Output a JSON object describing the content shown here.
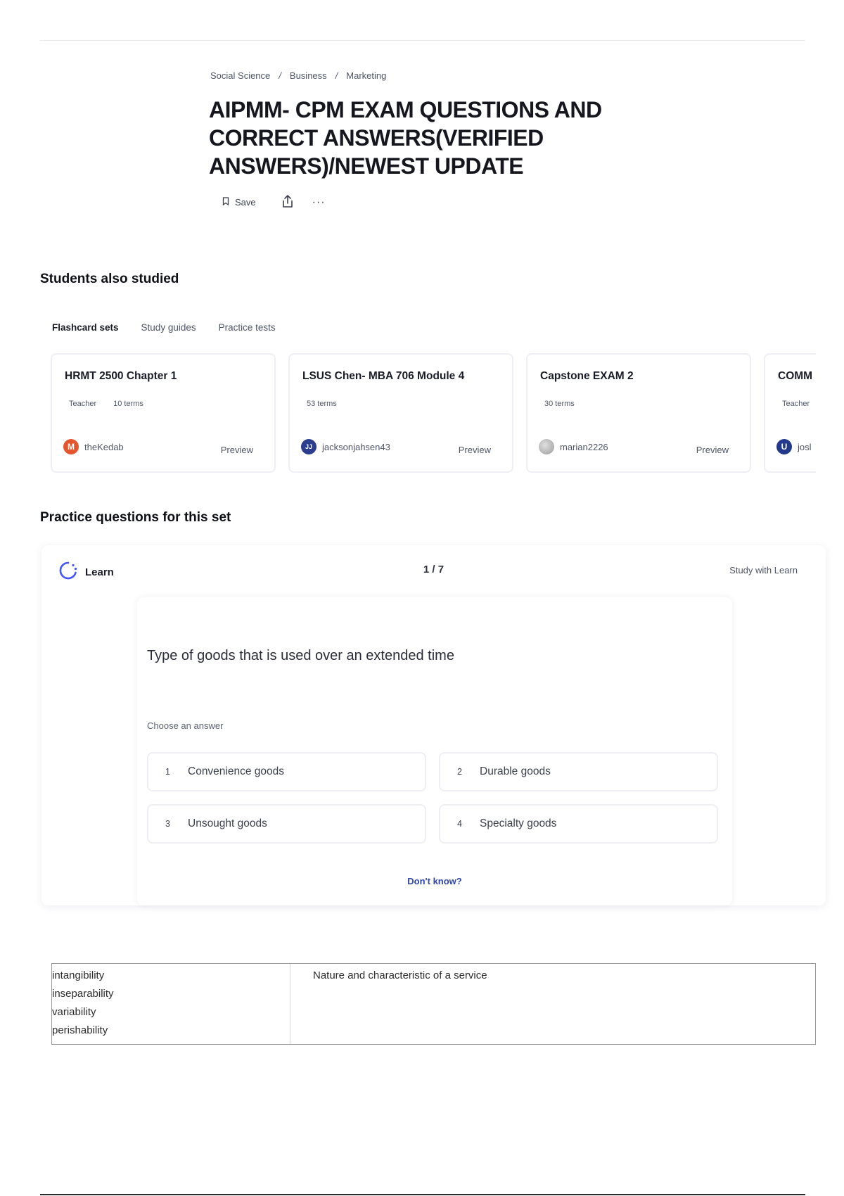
{
  "breadcrumb": [
    "Social Science",
    "Business",
    "Marketing"
  ],
  "breadcrumb_separator": "/",
  "title": "AIPMM- CPM EXAM QUESTIONS AND CORRECT ANSWERS(VERIFIED ANSWERS)/NEWEST UPDATE",
  "actions": {
    "save_label": "Save",
    "more_label": "···"
  },
  "also_studied": {
    "heading": "Students also studied",
    "tabs": [
      "Flashcard sets",
      "Study guides",
      "Practice tests"
    ],
    "cards": [
      {
        "title": "HRMT 2500 Chapter 1",
        "badge": "Teacher",
        "terms": "10 terms",
        "user": "theKedab",
        "avatar_letter": "M",
        "avatar_color": "#e4572e",
        "preview": "Preview"
      },
      {
        "title": "LSUS Chen- MBA 706 Module 4",
        "badge": "",
        "terms": "53 terms",
        "user": "jacksonjahsen43",
        "avatar_letter": "JJ",
        "avatar_color": "#2a3d8f",
        "preview": "Preview"
      },
      {
        "title": "Capstone EXAM 2",
        "badge": "",
        "terms": "30 terms",
        "user": "marian2226",
        "avatar_letter": "",
        "avatar_color": "#b9b9b9",
        "preview": "Preview"
      },
      {
        "title": "COMM",
        "badge": "Teacher",
        "terms": "",
        "user": "josl",
        "avatar_letter": "U",
        "avatar_color": "#233a8c",
        "preview": ""
      }
    ]
  },
  "practice": {
    "heading": "Practice questions for this set",
    "mode_label": "Learn",
    "counter": "1 / 7",
    "study_link": "Study with Learn",
    "question": "Type of goods that is used over an extended time",
    "choose_label": "Choose an answer",
    "options": [
      {
        "num": "1",
        "label": "Convenience goods"
      },
      {
        "num": "2",
        "label": "Durable goods"
      },
      {
        "num": "3",
        "label": "Unsought goods"
      },
      {
        "num": "4",
        "label": "Specialty goods"
      }
    ],
    "dont_know": "Don't know?"
  },
  "term_table": {
    "terms": [
      "intangibility",
      "inseparability",
      "variability",
      "perishability"
    ],
    "definition": "Nature and characteristic of a service"
  },
  "colors": {
    "accent": "#3046a8",
    "learn_icon": "#4255ff"
  }
}
